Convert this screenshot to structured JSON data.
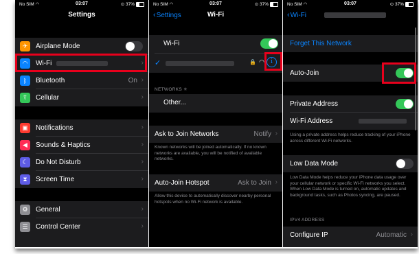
{
  "status": {
    "carrier": "No SIM",
    "time": "03:07",
    "battery": "37%"
  },
  "p1": {
    "title": "Settings",
    "rows": [
      {
        "label": "Airplane Mode",
        "icon": "airplane-icon",
        "color": "#ff9500"
      },
      {
        "label": "Wi-Fi",
        "icon": "wifi-icon",
        "color": "#0a84ff"
      },
      {
        "label": "Bluetooth",
        "icon": "bluetooth-icon",
        "color": "#0a84ff",
        "value": "On"
      },
      {
        "label": "Cellular",
        "icon": "cellular-icon",
        "color": "#34c759"
      },
      {
        "label": "Notifications",
        "icon": "notifications-icon",
        "color": "#ff3b30"
      },
      {
        "label": "Sounds & Haptics",
        "icon": "sound-icon",
        "color": "#ff2d55"
      },
      {
        "label": "Do Not Disturb",
        "icon": "moon-icon",
        "color": "#5e5ce6"
      },
      {
        "label": "Screen Time",
        "icon": "hourglass-icon",
        "color": "#5e5ce6"
      },
      {
        "label": "General",
        "icon": "gear-icon",
        "color": "#8e8e93"
      },
      {
        "label": "Control Center",
        "icon": "control-center-icon",
        "color": "#8e8e93"
      }
    ]
  },
  "p2": {
    "back": "Settings",
    "title": "Wi-Fi",
    "wifi_label": "Wi-Fi",
    "networks_header": "NETWORKS",
    "other": "Other...",
    "ask_label": "Ask to Join Networks",
    "ask_value": "Notify",
    "ask_note": "Known networks will be joined automatically. If no known networks are available, you will be notified of available networks.",
    "hotspot_label": "Auto-Join Hotspot",
    "hotspot_value": "Ask to Join",
    "hotspot_note": "Allow this device to automatically discover nearby personal hotspots when no Wi-Fi network is available."
  },
  "p3": {
    "back": "Wi-Fi",
    "forget": "Forget This Network",
    "autojoin": "Auto-Join",
    "private": "Private Address",
    "wifi_address": "Wi-Fi Address",
    "private_note": "Using a private address helps reduce tracking of your iPhone across different Wi-Fi networks.",
    "low_data": "Low Data Mode",
    "low_data_note": "Low Data Mode helps reduce your iPhone data usage over your cellular network or specific Wi-Fi networks you select. When Low Data Mode is turned on, automatic updates and background tasks, such as Photos syncing, are paused.",
    "ipv4_header": "IPV4 ADDRESS",
    "configure_ip": "Configure IP",
    "configure_value": "Automatic"
  }
}
